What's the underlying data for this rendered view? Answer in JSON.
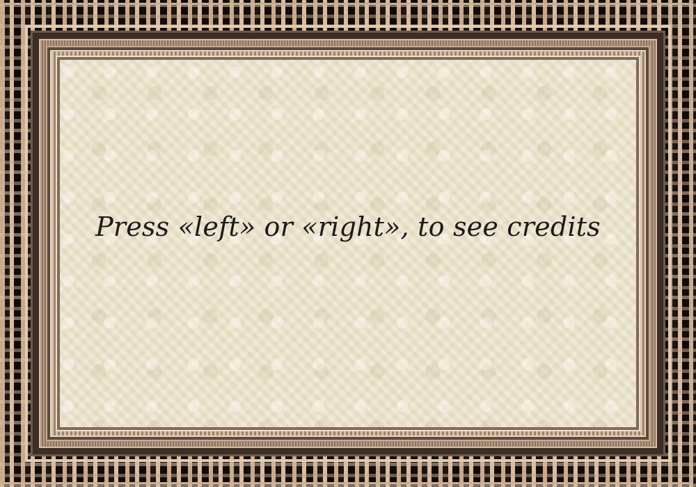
{
  "screen": {
    "prompt_text": "Press «left» or «right», to see credits"
  },
  "colors": {
    "parchment": "#ede4cc",
    "frame_dark": "#1b1511",
    "frame_gold": "#c9a98c",
    "text": "#1a1a1a"
  }
}
